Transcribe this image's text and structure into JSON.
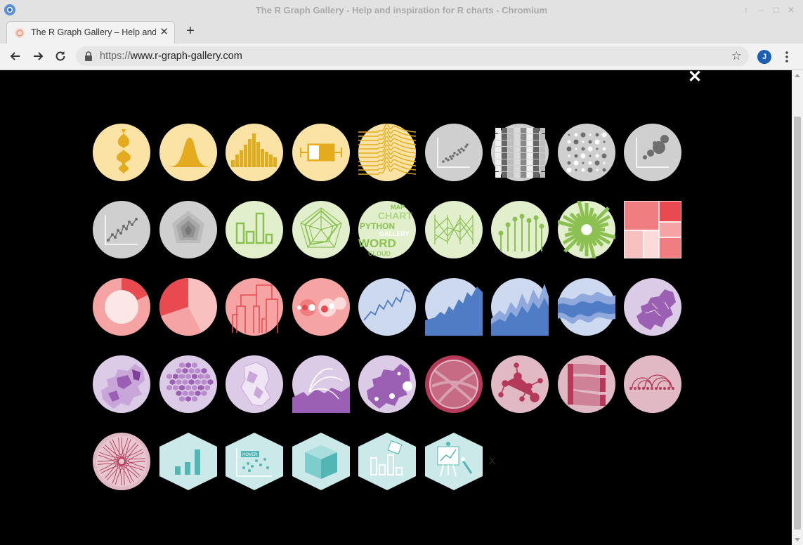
{
  "window": {
    "title": "The R Graph Gallery - Help and inspiration for R charts - Chromium"
  },
  "tab": {
    "title": "The R Graph Gallery – Help and inspiration for R charts",
    "close": "✕"
  },
  "newtab": {
    "label": "+"
  },
  "omnibox": {
    "scheme": "https://",
    "host": "www.r-graph-gallery.com"
  },
  "profile": {
    "initial": "J"
  },
  "overlay": {
    "close": "✕",
    "stray": "X"
  },
  "gallery": {
    "rows": [
      {
        "icons": [
          "violin-icon",
          "density-icon",
          "histogram-icon",
          "boxplot-icon",
          "ridgeline-icon",
          "scatter-icon",
          "heatmap-icon",
          "correlogram-icon",
          "bubble-icon"
        ]
      },
      {
        "icons": [
          "connected-scatter-icon",
          "density-2d-icon",
          "barplot-icon",
          "spider-icon",
          "wordcloud-icon",
          "parallel-icon",
          "lollipop-icon",
          "circular-barplot-icon",
          "treemap-icon"
        ]
      },
      {
        "icons": [
          "doughnut-icon",
          "pie-icon",
          "dendrogram-icon",
          "circle-packing-icon",
          "line-icon",
          "area-icon",
          "stacked-area-icon",
          "streamchart-icon",
          "map-icon"
        ]
      },
      {
        "icons": [
          "choropleth-icon",
          "hexbin-map-icon",
          "cartogram-icon",
          "connection-map-icon",
          "bubble-map-icon",
          "chord-icon",
          "network-icon",
          "sankey-icon",
          "arc-diagram-icon"
        ]
      },
      {
        "icons": [
          "edge-bundling-icon",
          "ggplot2-icon",
          "interactive-icon",
          "3d-icon",
          "animation-icon",
          "caveat-icon"
        ]
      }
    ],
    "wordcloud_words": [
      "CHART",
      "PYTHON",
      "GALLERY",
      "WORD",
      "CLOUD",
      "MAP"
    ],
    "interactive_label": "HOVER",
    "colors": {
      "yellow_bg": "#fbe3a6",
      "yellow": "#e5ab1e",
      "grey_bg": "#cfcfcf",
      "grey": "#6e6e6e",
      "green_bg": "#e2efcd",
      "green": "#8cc152",
      "red_bg": "#f5a3a3",
      "red": "#e84a4f",
      "blue_bg": "#cdd9ee",
      "blue": "#4f7cc4",
      "purple_bg": "#dccbe6",
      "purple": "#9b5fb4",
      "wine_bg": "#e0b9c4",
      "wine": "#b53a5a",
      "teal_bg": "#cbe9e9",
      "teal": "#52b6b4"
    }
  }
}
